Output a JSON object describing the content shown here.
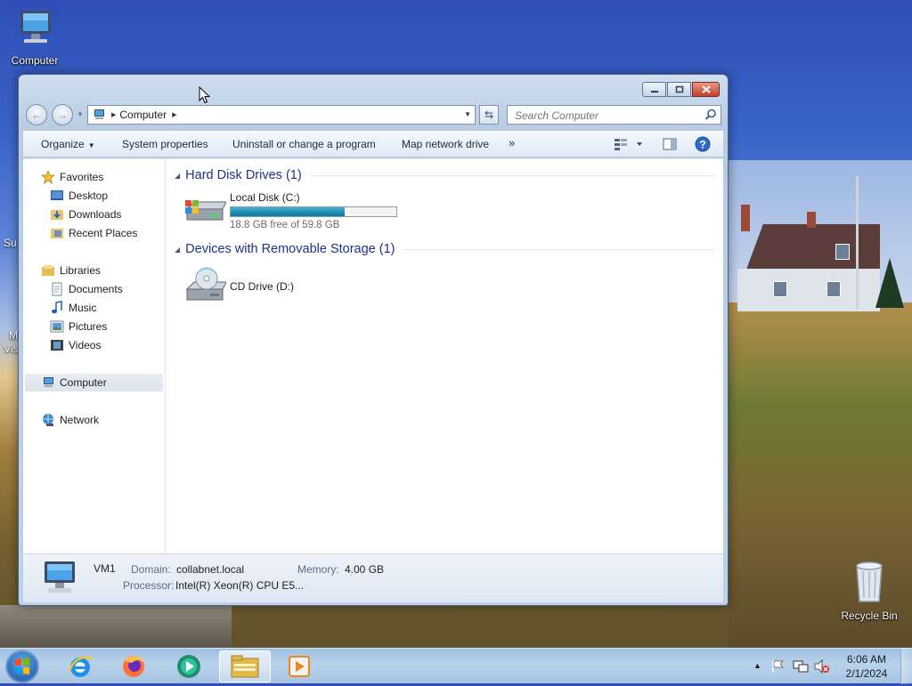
{
  "desktop": {
    "icons": [
      {
        "label": "Computer",
        "icon": "computer-icon"
      },
      {
        "label": "Recycle Bin",
        "icon": "recycle-bin-icon"
      }
    ],
    "partial_labels": [
      "Su",
      "M",
      "Vis"
    ]
  },
  "window": {
    "caption_buttons": [
      "minimize-icon",
      "restore-icon",
      "close-icon"
    ],
    "address": {
      "crumb": "Computer"
    },
    "search": {
      "placeholder": "Search Computer"
    },
    "toolbar": {
      "organize": "Organize",
      "system_properties": "System properties",
      "uninstall": "Uninstall or change a program",
      "map_drive": "Map network drive",
      "more": "»"
    },
    "nav": {
      "favorites": "Favorites",
      "desktop": "Desktop",
      "downloads": "Downloads",
      "recent": "Recent Places",
      "libraries": "Libraries",
      "documents": "Documents",
      "music": "Music",
      "pictures": "Pictures",
      "videos": "Videos",
      "computer": "Computer",
      "network": "Network"
    },
    "groups": {
      "hdd": "Hard Disk Drives (1)",
      "removable": "Devices with Removable Storage (1)"
    },
    "drives": {
      "c": {
        "name": "Local Disk (C:)",
        "free_text": "18.8 GB free of 59.8 GB",
        "used_fraction": 0.686
      },
      "d": {
        "name": "CD Drive (D:)"
      }
    },
    "details": {
      "name": "VM1",
      "domain_label": "Domain:",
      "domain_value": "collabnet.local",
      "memory_label": "Memory:",
      "memory_value": "4.00 GB",
      "processor_label": "Processor:",
      "processor_value": "Intel(R) Xeon(R) CPU E5..."
    }
  },
  "taskbar": {
    "apps": [
      "internet-explorer-icon",
      "firefox-icon",
      "media-app-icon",
      "file-explorer-icon",
      "media-player-icon"
    ],
    "active_app": "file-explorer-icon",
    "tray_icons": [
      "show-hidden-icons-icon",
      "action-center-flag-icon",
      "network-icon",
      "volume-muted-icon"
    ],
    "time": "6:06 AM",
    "date": "2/1/2024"
  },
  "colors": {
    "group_heading": "#1e3287",
    "progress_fill": "#1b8eb2",
    "taskbar": "#b8d2ea"
  }
}
